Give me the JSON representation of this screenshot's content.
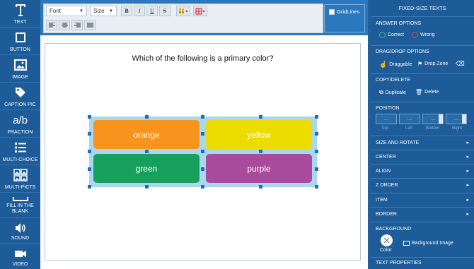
{
  "tools": [
    {
      "label": "TEXT",
      "icon": "text-icon"
    },
    {
      "label": "BUTTON",
      "icon": "button-icon"
    },
    {
      "label": "IMAGE",
      "icon": "image-icon"
    },
    {
      "label": "CAPTION PIC",
      "icon": "tag-icon"
    },
    {
      "label": "FRACTION",
      "icon": "fraction-icon"
    },
    {
      "label": "MULTI-CHOICE",
      "icon": "list-icon"
    },
    {
      "label": "MULTI-PICTS",
      "icon": "pictures-icon"
    },
    {
      "label": "FILL IN THE BLANK",
      "icon": "blank-icon"
    },
    {
      "label": "SOUND",
      "icon": "speaker-icon"
    },
    {
      "label": "VIDEO",
      "icon": "camera-icon"
    }
  ],
  "fraction_glyph": "a/b",
  "toolbar": {
    "font_label": "Font",
    "size_label": "Size",
    "bold": "B",
    "italic": "I",
    "underline": "U",
    "strike": "S",
    "gridlines_label": "GridLines"
  },
  "canvas": {
    "question": "Which of the following is a primary color?",
    "choices": [
      {
        "label": "orange",
        "color": "#f7941d"
      },
      {
        "label": "yellow",
        "color": "#eddc00"
      },
      {
        "label": "green",
        "color": "#17a05d"
      },
      {
        "label": "purple",
        "color": "#a94a9c"
      }
    ]
  },
  "panel": {
    "title": "FIXED-SIZE TEXTS",
    "answer_options": "ANSWER OPTIONS",
    "correct": "Correct",
    "wrong": "Wrong",
    "dragdrop": "DRAG/DROP OPTIONS",
    "draggable": "Draggable",
    "dropzone": "Drop Zone",
    "copydelete": "COPY/DELETE",
    "duplicate": "Duplicate",
    "delete": "Delete",
    "position": "POSITION",
    "pos_placeholder": "....",
    "top": "Top",
    "left": "Left",
    "bottom": "Bottom",
    "right": "Right",
    "size_rotate": "SIZE AND ROTATE",
    "center": "CENTER",
    "align": "ALIGN",
    "zorder": "Z ORDER",
    "item": "ITEM",
    "border": "BORDER",
    "background": "BACKGROUND",
    "color": "Color",
    "bg_image": "Background Image",
    "text_props": "TEXT PROPERTIES"
  }
}
